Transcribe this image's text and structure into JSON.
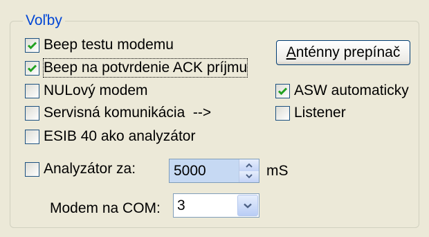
{
  "group": {
    "title": "Voľby"
  },
  "checkboxes": {
    "beep_test": {
      "label": "Beep testu modemu",
      "checked": true
    },
    "beep_ack": {
      "label": "Beep na potvrdenie ACK príjmu",
      "checked": true
    },
    "null_modem": {
      "label": "NULový modem",
      "checked": false
    },
    "service_comm": {
      "label": "Servisná komunikácia  -->",
      "checked": false
    },
    "esib": {
      "label": "ESIB 40 ako analyzátor",
      "checked": false
    },
    "asw_auto": {
      "label": "ASW automaticky",
      "checked": true
    },
    "listener": {
      "label": "Listener",
      "checked": false
    },
    "analyzer_for": {
      "label": "Analyzátor za:",
      "checked": false
    }
  },
  "antenna_button": {
    "accel": "A",
    "rest": "nténny prepínač"
  },
  "analyzer_spin": {
    "value": "5000",
    "unit": "mS"
  },
  "modem_com": {
    "label": "Modem na COM:",
    "value": "3"
  },
  "colors": {
    "group_title": "#0046d5",
    "check": "#21a121",
    "window_bg": "#ece9d8"
  },
  "icons": {
    "check": "check-icon",
    "spin_up": "spin-up-icon",
    "spin_down": "spin-down-icon",
    "dropdown": "chevron-down-icon"
  }
}
